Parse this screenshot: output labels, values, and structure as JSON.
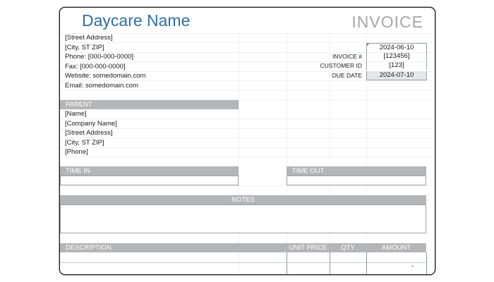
{
  "header": {
    "company_name": "Daycare Name",
    "doc_title": "INVOICE"
  },
  "sender": {
    "street": "[Street Address]",
    "city": "[City, ST  ZIP]",
    "phone": "Phone: [000-000-0000]",
    "fax": "Fax: [000-000-0000]",
    "website": "Website: somedomain.com",
    "email": "Email: somedomain.com"
  },
  "meta": {
    "date_value": "2024-06-10",
    "invoice_label": "INVOICE #",
    "invoice_value": "[123456]",
    "customer_label": "CUSTOMER ID",
    "customer_value": "[123]",
    "due_label": "DUE DATE",
    "due_value": "2024-07-10"
  },
  "parent": {
    "header": "PARENT",
    "name": "[Name]",
    "company": "[Company Name]",
    "street": "[Street Address]",
    "city": "[City, ST  ZIP]",
    "phone": "[Phone]"
  },
  "time": {
    "in_label": "TIME IN",
    "out_label": "TIME OUT"
  },
  "notes": {
    "label": "NOTES"
  },
  "items_table": {
    "headers": {
      "description": "DESCRIPTION",
      "unit_price": "UNIT PRICE",
      "qty": "QTY",
      "amount": "AMOUNT"
    },
    "rows": [
      {
        "description": "",
        "unit_price": "",
        "qty": "",
        "amount": "-"
      }
    ]
  },
  "colors": {
    "title_blue": "#2f6ea5",
    "header_gray": "#b3b6b9",
    "invoice_gray": "#a6a6a6",
    "marker_green": "#2e8b57"
  }
}
